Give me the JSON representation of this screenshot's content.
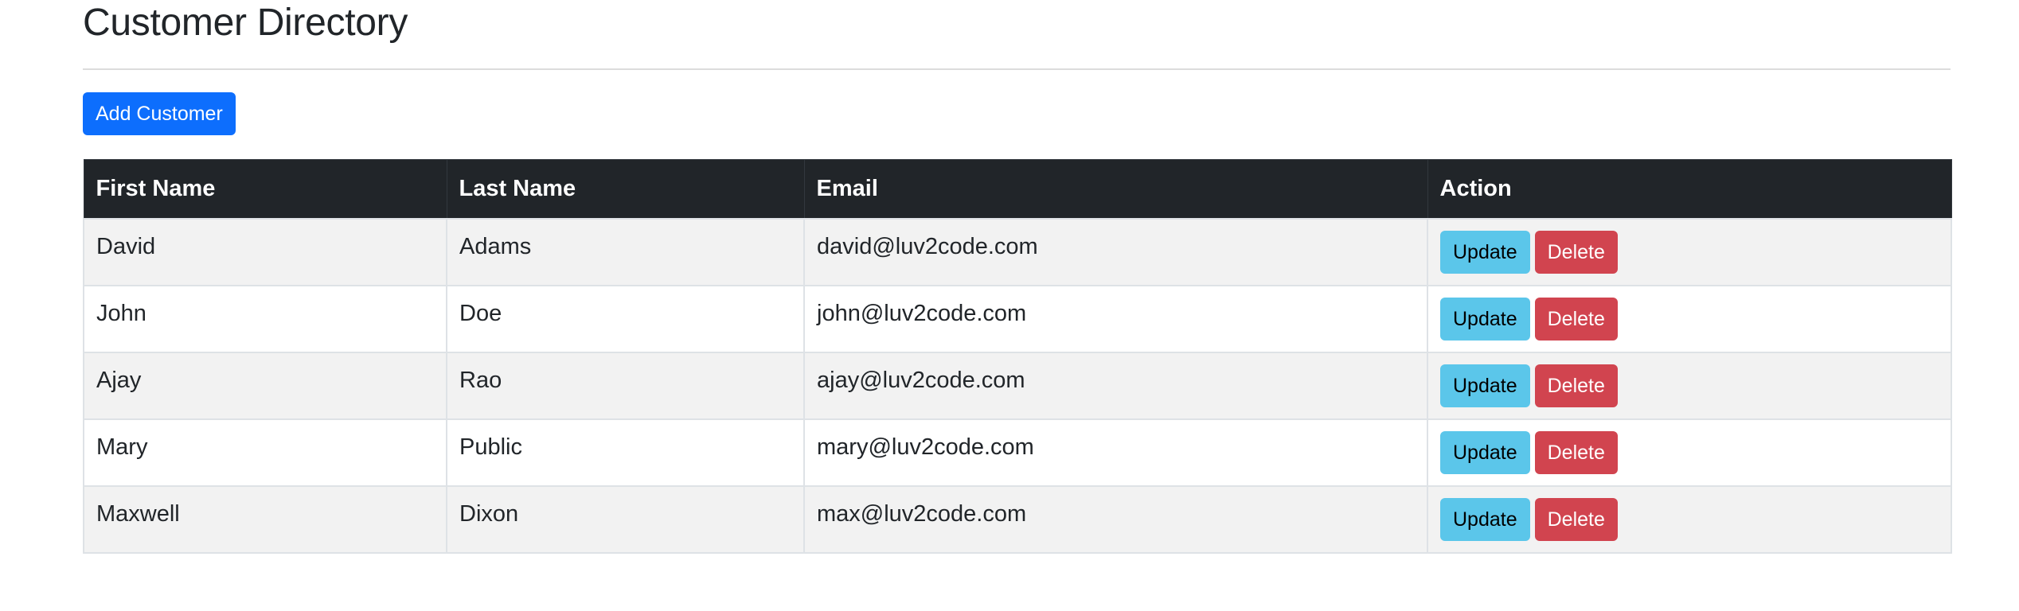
{
  "page": {
    "title": "Customer Directory",
    "add_button_label": "Add Customer"
  },
  "table": {
    "headers": {
      "first_name": "First Name",
      "last_name": "Last Name",
      "email": "Email",
      "action": "Action"
    },
    "rows": [
      {
        "first_name": "David",
        "last_name": "Adams",
        "email": "david@luv2code.com",
        "update_label": "Update",
        "delete_label": "Delete"
      },
      {
        "first_name": "John",
        "last_name": "Doe",
        "email": "john@luv2code.com",
        "update_label": "Update",
        "delete_label": "Delete"
      },
      {
        "first_name": "Ajay",
        "last_name": "Rao",
        "email": "ajay@luv2code.com",
        "update_label": "Update",
        "delete_label": "Delete"
      },
      {
        "first_name": "Mary",
        "last_name": "Public",
        "email": "mary@luv2code.com",
        "update_label": "Update",
        "delete_label": "Delete"
      },
      {
        "first_name": "Maxwell",
        "last_name": "Dixon",
        "email": "max@luv2code.com",
        "update_label": "Update",
        "delete_label": "Delete"
      }
    ]
  },
  "colors": {
    "primary": "#0d6efd",
    "info": "#5bc6ea",
    "danger": "#d1444f",
    "header_bg": "#212529",
    "stripe_bg": "#f2f2f2"
  }
}
